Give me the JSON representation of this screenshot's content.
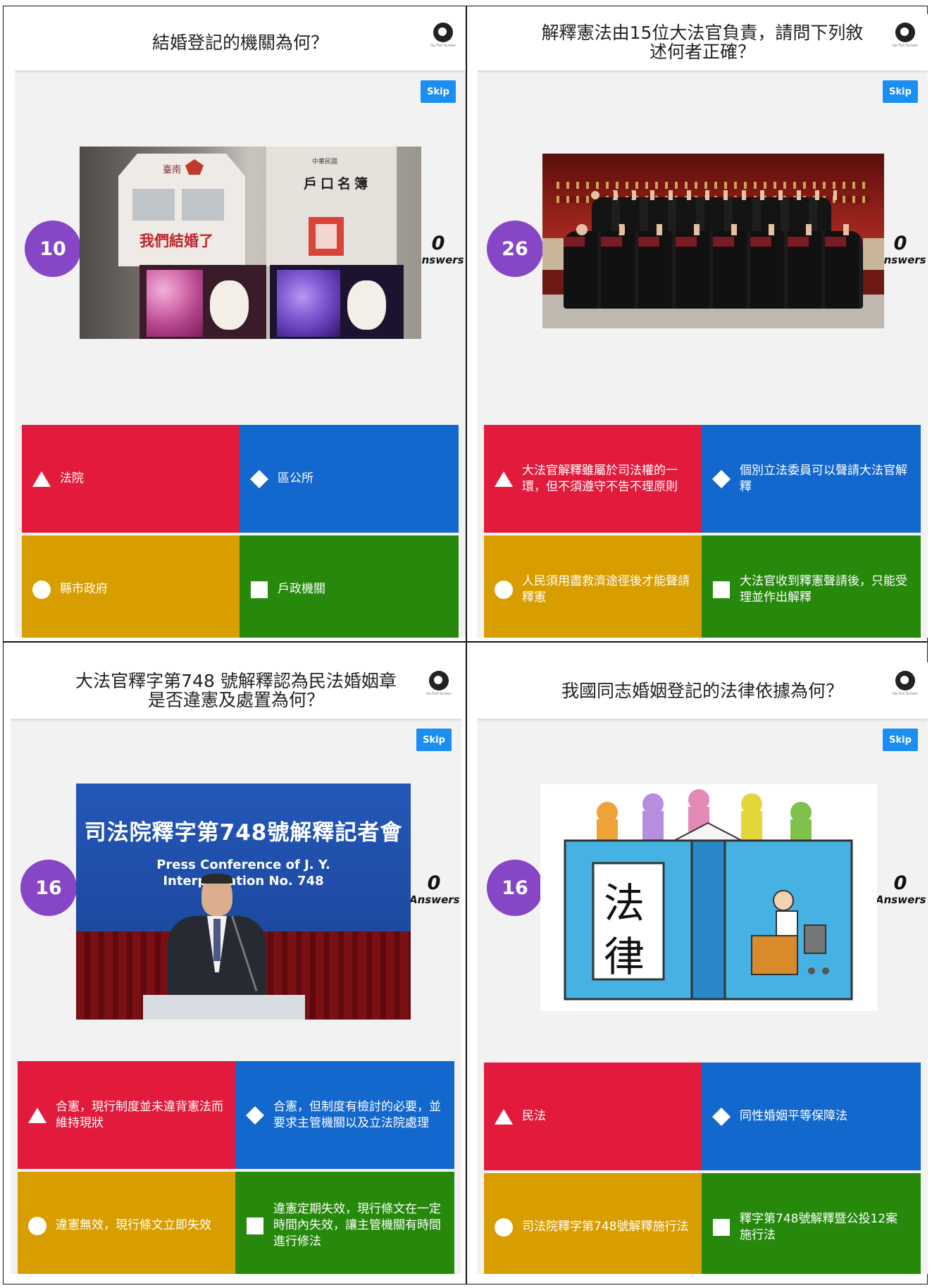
{
  "colors": {
    "red": "#e21b3c",
    "blue": "#1368ce",
    "yellow": "#d89e00",
    "green": "#26890c",
    "purple": "#8646c6",
    "skip": "#1b8ef2"
  },
  "ui": {
    "skip_label": "Skip",
    "answers_label": "Answers",
    "fullscreen_label": "Go Full Screen"
  },
  "panels": [
    {
      "question": "結婚登記的機關為何？",
      "timer": "10",
      "answers_count": "0",
      "image": {
        "icon": "wedding-gift-photo",
        "texts": {
          "city": "臺南",
          "card": "我們結婚了",
          "book_top": "中華民國",
          "book_title": "戶口名簿"
        }
      },
      "options": [
        "法院",
        "區公所",
        "縣市政府",
        "戶政機關"
      ]
    },
    {
      "question": "解釋憲法由15位大法官負責，請問下列敘述何者正確？",
      "timer": "26",
      "answers_count": "0",
      "image": {
        "icon": "justices-group-photo"
      },
      "options": [
        "大法官解釋雖屬於司法權的一環，但不須遵守不告不理原則",
        "個別立法委員可以聲請大法官解釋",
        "人民須用盡救濟途徑後才能聲請釋憲",
        "大法官收到釋憲聲請後，只能受理並作出解釋"
      ]
    },
    {
      "question": "大法官釋字第748 號解釋認為民法婚姻章是否違憲及處置為何？",
      "timer": "16",
      "answers_count": "0",
      "image": {
        "icon": "press-conference-photo",
        "texts": {
          "banner_cn": "司法院釋字第748號解釋記者會",
          "banner_en1": "Press Conference of J. Y.",
          "banner_en2": "Interpretation No. 748"
        }
      },
      "options": [
        "合憲，現行制度並未違背憲法而維持現狀",
        "合憲，但制度有檢討的必要，並要求主管機關以及立法院處理",
        "違憲無效，現行條文立即失效",
        "違憲定期失效，現行條文在一定時間內失效，讓主管機關有時間進行修法"
      ]
    },
    {
      "question": "我國同志婚姻登記的法律依據為何？",
      "timer": "16",
      "answers_count": "0",
      "image": {
        "icon": "law-book-illustration",
        "texts": {
          "book_char1": "法",
          "book_char2": "律"
        }
      },
      "options": [
        "民法",
        "同性婚姻平等保障法",
        "司法院釋字第748號解釋施行法",
        "釋字第748號解釋暨公投12案施行法"
      ]
    }
  ]
}
